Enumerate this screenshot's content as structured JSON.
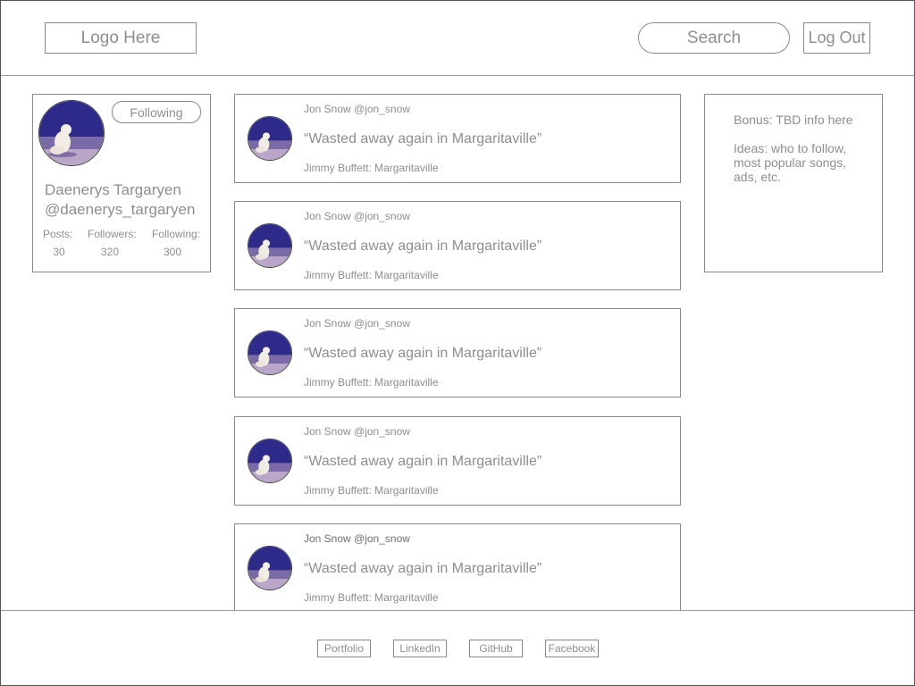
{
  "header": {
    "logo_text": "Logo Here",
    "search_label": "Search",
    "logout_label": "Log Out"
  },
  "profile": {
    "following_label": "Following",
    "name": "Daenerys Targaryen",
    "handle": "@daenerys_targaryen",
    "stats": [
      {
        "label": "Posts:",
        "value": "30"
      },
      {
        "label": "Followers:",
        "value": "320"
      },
      {
        "label": "Following:",
        "value": "300"
      }
    ]
  },
  "feed": {
    "posts": [
      {
        "author": "Jon Snow @jon_snow",
        "quote": "“Wasted away again in Margaritaville”",
        "source": "Jimmy Buffett: Margaritaville"
      },
      {
        "author": "Jon Snow @jon_snow",
        "quote": "“Wasted away again in Margaritaville”",
        "source": "Jimmy Buffett: Margaritaville"
      },
      {
        "author": "Jon Snow @jon_snow",
        "quote": "“Wasted away again in Margaritaville”",
        "source": "Jimmy Buffett: Margaritaville"
      },
      {
        "author": "Jon Snow @jon_snow",
        "quote": "“Wasted away again in Margaritaville”",
        "source": "Jimmy Buffett: Margaritaville"
      },
      {
        "author": "Jon Snow @jon_snow",
        "quote": "“Wasted away again in Margaritaville”",
        "source": "Jimmy Buffett: Margaritaville"
      }
    ]
  },
  "info": {
    "bonus": "Bonus: TBD info here",
    "ideas": "Ideas: who to follow, most popular songs, ads, etc."
  },
  "footer": {
    "links": [
      "Portfolio",
      "LinkedIn",
      "GitHub",
      "Facebook"
    ]
  }
}
